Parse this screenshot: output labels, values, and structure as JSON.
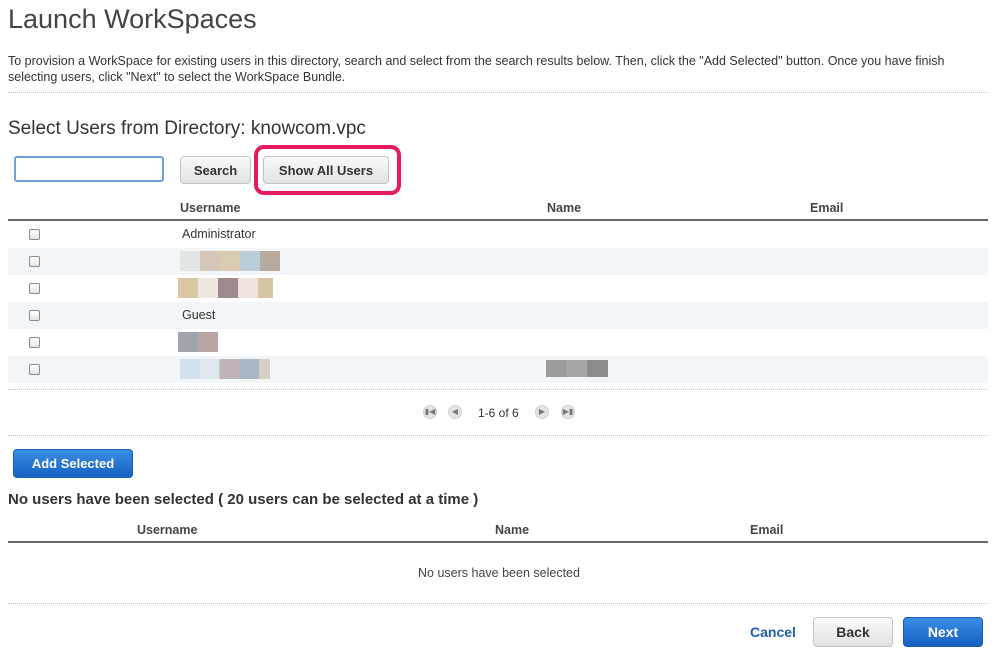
{
  "page": {
    "title": "Launch WorkSpaces",
    "intro": "To provision a WorkSpace for existing users in this directory, search and select from the search results below. Then, click the \"Add Selected\" button. Once you have finish selecting users, click \"Next\" to select the WorkSpace Bundle."
  },
  "directory": {
    "section_title": "Select Users from Directory: knowcom.vpc",
    "search_value": "",
    "search_button": "Search",
    "show_all_button": "Show All Users",
    "highlight_color": "#e8195d"
  },
  "users_table": {
    "columns": {
      "username": "Username",
      "name": "Name",
      "email": "Email"
    },
    "rows": [
      {
        "username": "Administrator",
        "checked": false
      },
      {
        "username": "",
        "checked": false
      },
      {
        "username": "",
        "checked": false
      },
      {
        "username": "Guest",
        "checked": false
      },
      {
        "username": "",
        "checked": false
      },
      {
        "username": "",
        "checked": false
      }
    ],
    "pager": {
      "label": "1-6 of 6",
      "icons": [
        "first-page-icon",
        "prev-page-icon",
        "next-page-icon",
        "last-page-icon"
      ]
    }
  },
  "selection": {
    "add_selected_button": "Add Selected",
    "title": "No users have been selected ( 20 users can be selected at a time )",
    "columns": {
      "username": "Username",
      "name": "Name",
      "email": "Email"
    },
    "empty_message": "No users have been selected"
  },
  "footer": {
    "cancel": "Cancel",
    "back": "Back",
    "next": "Next"
  },
  "colors": {
    "primary": "#1f6fd1",
    "link": "#1f5fa8"
  }
}
